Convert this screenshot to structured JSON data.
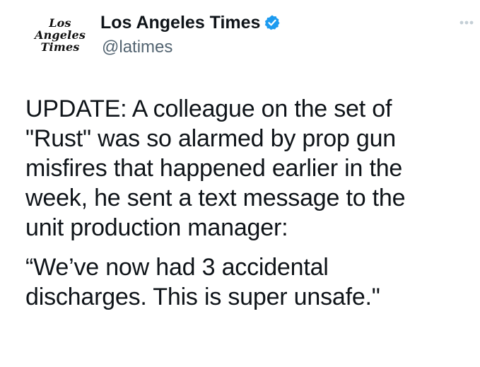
{
  "account": {
    "avatar_lines": [
      "Los",
      "Angeles",
      "Times"
    ],
    "display_name": "Los Angeles Times",
    "handle": "@latimes",
    "verified_icon": "verified-badge-icon",
    "verified_color": "#1d9bf0"
  },
  "menu": {
    "icon": "more-options-icon"
  },
  "tweet": {
    "paragraphs": [
      "UPDATE: A colleague on the set of\n\"Rust\" was so alarmed by prop gun\nmisfires that happened earlier in the\nweek, he sent a text message to the\nunit production manager:",
      "“We’ve now had 3 accidental\ndischarges. This is super unsafe.\""
    ]
  },
  "colors": {
    "text": "#0f1419",
    "secondary": "#536471",
    "background": "#ffffff"
  }
}
